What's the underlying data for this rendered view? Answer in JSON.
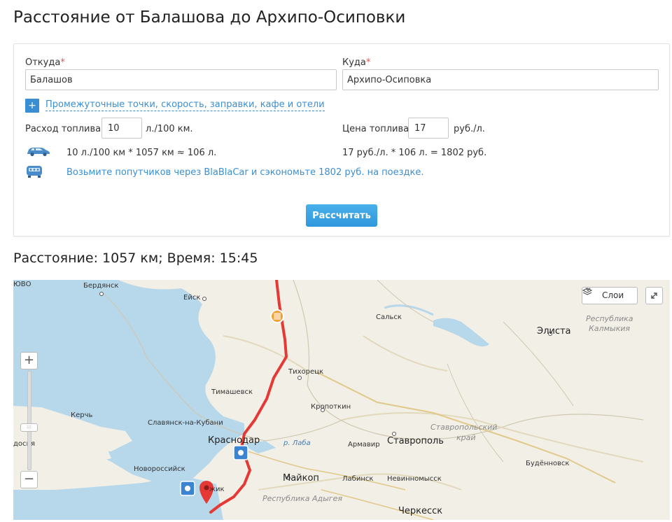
{
  "page": {
    "title": "Расстояние от Балашова до Архипо-Осиповки"
  },
  "form": {
    "from_label": "Откуда",
    "to_label": "Куда",
    "required_mark": "*",
    "from_value": "Балашов",
    "to_value": "Архипо-Осиповка",
    "plus_label": "+",
    "extra_link": "Промежуточные точки, скорость, заправки, кафе и отели",
    "consumption_label": "Расход топлива",
    "consumption_value": "10",
    "consumption_unit": "л./100 км.",
    "price_label": "Цена топлива",
    "price_value": "17",
    "price_unit": "руб./л.",
    "fuel_calc": "10 л./100 км * 1057 км ≈ 106 л.",
    "cost_calc": "17 руб./л. * 106 л. = 1802 руб.",
    "blablacar_text": "Возьмите попутчиков через BlaBlaCar и сэкономьте 1802 руб. на поездке.",
    "calculate_button": "Рассчитать"
  },
  "result": {
    "summary": "Расстояние: 1057 км; Время: 15:45"
  },
  "map": {
    "layers_button": "Слои",
    "zoom_in": "+",
    "zoom_out": "−",
    "zoom_thumb": ":::",
    "route_color": "#e53935",
    "labels": {
      "berdyansk": "Бердянск",
      "eysk": "Ейск",
      "salsk": "Сальск",
      "elista": "Элиста",
      "kalmykia_1": "Республика",
      "kalmykia_2": "Калмыкия",
      "tikhoretsk": "Тихорецк",
      "timashevsk": "Тимашевск",
      "kropotkin": "Кропоткин",
      "kerch": "Керчь",
      "slavyansk": "Славянск-на-Кубани",
      "krasnodar": "Краснодар",
      "laba": "р. Лаба",
      "armavir": "Армавир",
      "stavropol": "Ставрополь",
      "stavropol_krai_1": "Ставропольский",
      "stavropol_krai_2": "край",
      "novorossiysk": "Новороссийск",
      "budennovsk": "Будённовск",
      "maikop": "Майкоп",
      "labinsk": "Лабинск",
      "nevinnomyssk": "Невинномысск",
      "adygea": "Республика Адыгея",
      "cherkessk": "Черкесск",
      "gelendzhik": "жик",
      "feodosia": "досия",
      "partial_top": "ЮВО"
    }
  }
}
